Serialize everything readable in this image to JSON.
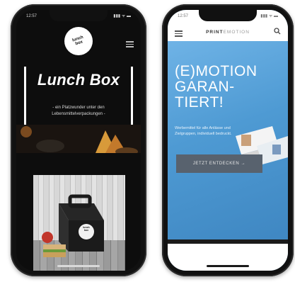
{
  "left_phone": {
    "status": {
      "time": "12:57",
      "signal": "▮▮▮ ᯤ ▬"
    },
    "logo_text": "lunch\nbox",
    "hero_title": "Lunch Box",
    "hero_subtitle": "- ein Platzwunder unter den Lebensmittelverpackungen -",
    "product_logo_text": "lunch\nbox"
  },
  "right_phone": {
    "status": {
      "time": "12:57",
      "signal": "▮▮▮ ᯤ ▬"
    },
    "brand_main": "PRINT",
    "brand_accent": "EMOTION",
    "hero_lines": [
      "(E)MOTION",
      "GARAN-",
      "TIERT!"
    ],
    "hero_subtitle": "Werbemittel für alle Anlässe und Zielgruppen, individuell bedruckt.",
    "cta_label": "JETZT ENTDECKEN →"
  },
  "colors": {
    "left_bg": "#0d0d0d",
    "right_hero": "#4e9ad3",
    "cta_bg": "#58626e"
  }
}
